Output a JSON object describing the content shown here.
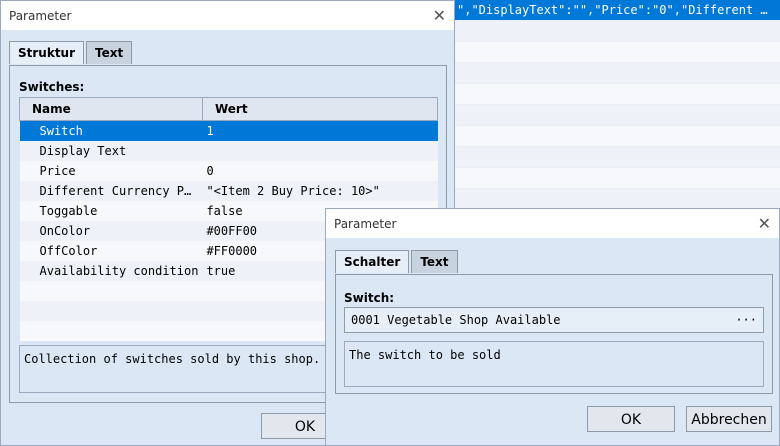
{
  "background_list": {
    "selected_text": "\",\"DisplayText\":\"\",\"Price\":\"0\",\"Different …"
  },
  "dialog1": {
    "title": "Parameter",
    "close_glyph": "✕",
    "tabs": [
      {
        "label": "Struktur",
        "active": true
      },
      {
        "label": "Text",
        "active": false
      }
    ],
    "section_label": "Switches:",
    "columns": [
      "Name",
      "Wert"
    ],
    "rows": [
      {
        "name": "Switch",
        "value": "1",
        "selected": true
      },
      {
        "name": "Display Text",
        "value": ""
      },
      {
        "name": "Price",
        "value": "0"
      },
      {
        "name": "Different Currency P…",
        "value": "\"<Item 2 Buy Price: 10>\""
      },
      {
        "name": "Toggable",
        "value": "false"
      },
      {
        "name": "OnColor",
        "value": "#00FF00"
      },
      {
        "name": "OffColor",
        "value": "#FF0000"
      },
      {
        "name": "Availability condition",
        "value": "true"
      }
    ],
    "description": "Collection of switches sold by this shop.",
    "ok_label": "OK"
  },
  "dialog2": {
    "title": "Parameter",
    "close_glyph": "✕",
    "tabs": [
      {
        "label": "Schalter",
        "active": true
      },
      {
        "label": "Text",
        "active": false
      }
    ],
    "field_label": "Switch:",
    "field_value": "0001 Vegetable Shop Available",
    "field_button": "···",
    "description": "The switch to be sold",
    "ok_label": "OK",
    "cancel_label": "Abbrechen"
  },
  "colors": {
    "selection": "#0078d7",
    "dialog_bg": "#dce7f5"
  }
}
